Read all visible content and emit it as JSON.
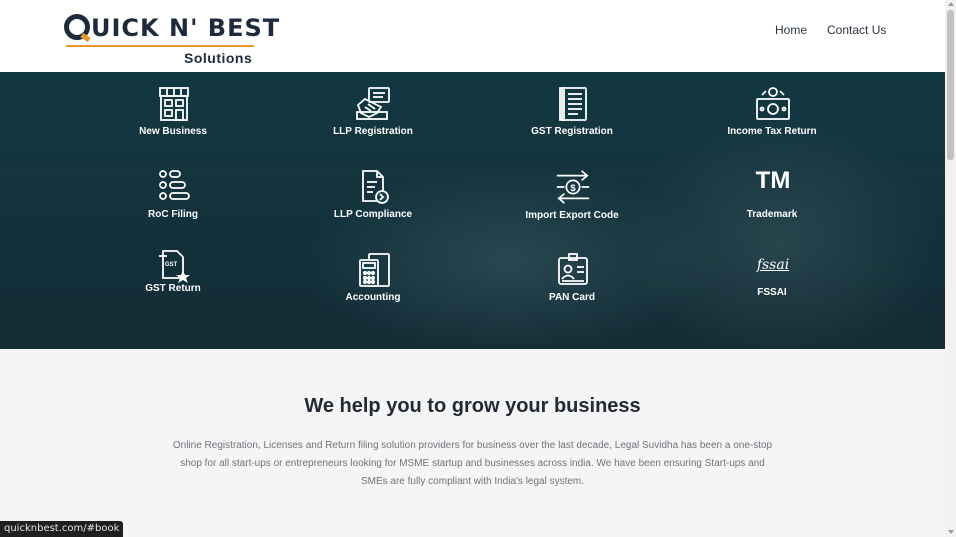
{
  "header": {
    "logo": {
      "main": "UICK N' BEST",
      "sub": "Solutions"
    },
    "nav": {
      "home": "Home",
      "contact": "Contact Us"
    }
  },
  "services": [
    {
      "label": "New Business",
      "icon": "storefront-icon"
    },
    {
      "label": "LLP Registration",
      "icon": "handshake-icon"
    },
    {
      "label": "GST Registration",
      "icon": "document-list-icon"
    },
    {
      "label": "Income Tax Return",
      "icon": "money-return-icon"
    },
    {
      "label": "RoC Filing",
      "icon": "toggle-list-icon"
    },
    {
      "label": "LLP Compliance",
      "icon": "document-arrow-icon"
    },
    {
      "label": "Import Export Code",
      "icon": "exchange-arrows-icon"
    },
    {
      "label": "Trademark",
      "icon": "trademark-icon",
      "icon_text": "TM"
    },
    {
      "label": "GST Return",
      "icon": "gst-document-star-icon"
    },
    {
      "label": "Accounting",
      "icon": "calculator-ledger-icon"
    },
    {
      "label": "PAN Card",
      "icon": "id-card-icon"
    },
    {
      "label": "FSSAI",
      "icon": "fssai-logo-icon",
      "icon_text": "fssai"
    }
  ],
  "main": {
    "title": "We help you to grow your business",
    "description": "Online Registration, Licenses and Return filing solution providers for business over the last decade, Legal Suvidha has been a one-stop shop for all start-ups or entrepreneurs looking for MSME startup and businesses across india. We have been ensuring Start-ups and SMEs are fully compliant with India's legal system."
  },
  "status_bar": {
    "url": "quicknbest.com/#book"
  },
  "colors": {
    "brand_dark": "#1e2b3c",
    "brand_accent": "#e8962a",
    "hero": "#17474f"
  }
}
